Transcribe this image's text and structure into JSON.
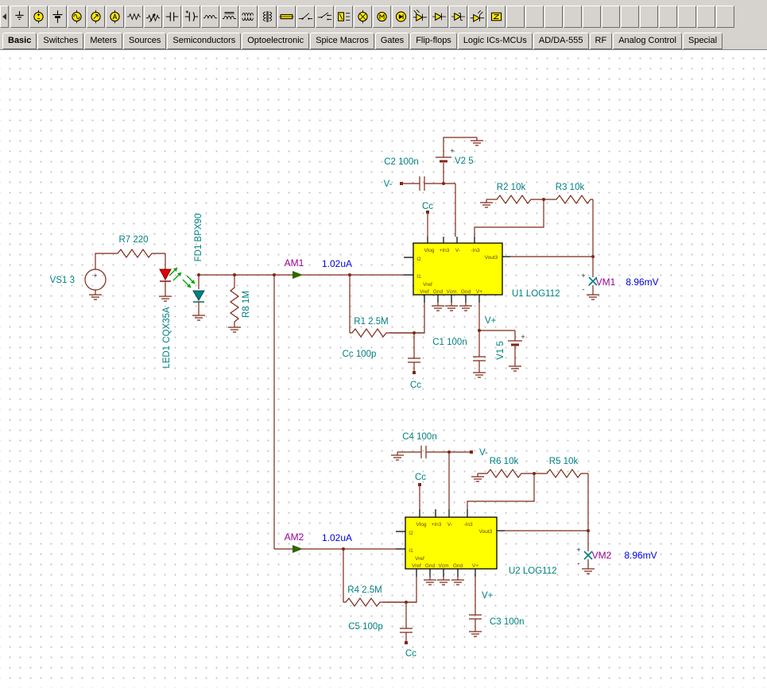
{
  "toolbar": {
    "icons": [
      {
        "name": "ground",
        "sym": "ground"
      },
      {
        "name": "voltage-source",
        "sym": "vsource"
      },
      {
        "name": "battery",
        "sym": "battery"
      },
      {
        "name": "voltage-generator",
        "sym": "gen-sine"
      },
      {
        "name": "current-source",
        "sym": "gen-arrow"
      },
      {
        "name": "current-generator",
        "sym": "gen-a"
      },
      {
        "name": "resistor",
        "sym": "resistor"
      },
      {
        "name": "potentiometer",
        "sym": "pot"
      },
      {
        "name": "capacitor",
        "sym": "cap"
      },
      {
        "name": "polarized-capacitor",
        "sym": "cap-pol"
      },
      {
        "name": "inductor",
        "sym": "inductor"
      },
      {
        "name": "iron-core-inductor",
        "sym": "inductor-core"
      },
      {
        "name": "coupled-inductors",
        "sym": "coupled"
      },
      {
        "name": "transformer",
        "sym": "transformer"
      },
      {
        "name": "fuse",
        "sym": "fuse"
      },
      {
        "name": "spst-switch",
        "sym": "switch"
      },
      {
        "name": "spdt-switch",
        "sym": "switch2"
      },
      {
        "name": "relay",
        "sym": "relay"
      },
      {
        "name": "lamp",
        "sym": "lamp"
      },
      {
        "name": "motor",
        "sym": "motor"
      },
      {
        "name": "optocoupler",
        "sym": "opto"
      },
      {
        "name": "photodiode",
        "sym": "photodiode"
      },
      {
        "name": "diode",
        "sym": "diode"
      },
      {
        "name": "zener-diode",
        "sym": "zener"
      },
      {
        "name": "led",
        "sym": "led"
      },
      {
        "name": "impedance",
        "sym": "zbox"
      }
    ],
    "empty_slots": 12
  },
  "tabs": {
    "items": [
      {
        "label": "Basic",
        "active": true
      },
      {
        "label": "Switches"
      },
      {
        "label": "Meters"
      },
      {
        "label": "Sources"
      },
      {
        "label": "Semiconductors"
      },
      {
        "label": "Optoelectronic"
      },
      {
        "label": "Spice Macros"
      },
      {
        "label": "Gates"
      },
      {
        "label": "Flip-flops"
      },
      {
        "label": "Logic ICs-MCUs"
      },
      {
        "label": "AD/DA-555"
      },
      {
        "label": "RF"
      },
      {
        "label": "Analog Control"
      },
      {
        "label": "Special"
      }
    ]
  },
  "schematic": {
    "sources": {
      "vs1": "VS1 3",
      "v1": "V1 5",
      "v2": "V2 5",
      "plus": "+",
      "minus": "-"
    },
    "resistors": {
      "r1": "R1 2.5M",
      "r2": "R2 10k",
      "r3": "R3 10k",
      "r4": "R4 2.5M",
      "r5": "R5 10k",
      "r6": "R6 10k",
      "r7": "R7 220",
      "r8": "R8 1M"
    },
    "capacitors": {
      "c1": "C1 100n",
      "c2": "C2 100n",
      "c3": "C3 100n",
      "c4": "C4 100n",
      "c5": "C5 100p",
      "cc": "Cc",
      "cc100p": "Cc 100p"
    },
    "diodes": {
      "led1": "LED1 CQX35A",
      "fd1": "FD1 BPX90"
    },
    "ics": {
      "u1": "U1 LOG112",
      "u2": "U2 LOG112"
    },
    "meters": {
      "am1": "AM1",
      "am1_value": "1.02uA",
      "am2": "AM2",
      "am2_value": "1.02uA",
      "vm1": "VM1",
      "vm1_value": "8.96mV",
      "vm2": "VM2",
      "vm2_value": "8.96mV"
    },
    "nets": {
      "v_minus": "V-",
      "v_plus": "V+"
    },
    "pins": {
      "vlog": "Vlog",
      "in3p": "+In3",
      "vminus": "V-",
      "in3m": "-In3",
      "vout3": "Vout3",
      "i2": "I2",
      "i1": "I1",
      "vref": "Vref",
      "gnd": "Gnd",
      "vcm": "Vcm",
      "vplus": "V+"
    }
  },
  "colors": {
    "wire": "#7e2817",
    "label": "#008080",
    "meter_label": "#990099",
    "meter_value": "#0000dd",
    "ic_fill": "#ffff00",
    "led_red": "#e00000",
    "photo_teal": "#007f7f",
    "arrow_green": "#00a000",
    "toolbar_bg": "#d6d3ce",
    "grid_dot": "#c2c2c2"
  }
}
